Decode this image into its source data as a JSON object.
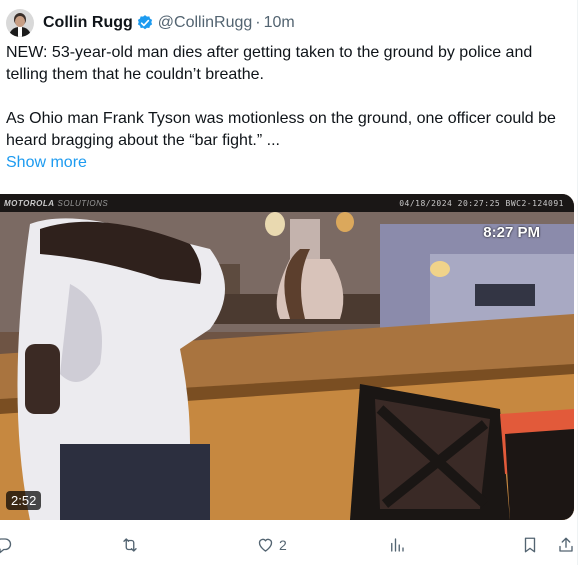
{
  "tweet": {
    "author_name": "Collin Rugg",
    "handle": "@CollinRugg",
    "separator": "·",
    "time": "10m",
    "text_line1": "NEW: 53-year-old man dies after getting taken to the ground by police and telling them that he couldn’t breathe.",
    "text_line2": "As Ohio man Frank Tyson was motionless on the ground, one officer could be heard bragging about the “bar fight.” ...",
    "show_more": "Show more",
    "verified": true
  },
  "video": {
    "brand": "MOTOROLA",
    "brand_sub": "SOLUTIONS",
    "stamp": "04/18/2024 20:27:25  BWC2-124091",
    "overlay_time": "8:27 PM",
    "duration": "2:52"
  },
  "actions": {
    "reply_count": "",
    "retweet_count": "",
    "like_count": "2",
    "views_count": ""
  },
  "icons": [
    "verified-badge-icon",
    "reply-icon",
    "retweet-icon",
    "like-icon",
    "views-icon",
    "bookmark-icon",
    "share-icon"
  ],
  "colors": {
    "link": "#1d9bf0",
    "secondary_text": "#536471",
    "verified": "#1d9bf0"
  }
}
